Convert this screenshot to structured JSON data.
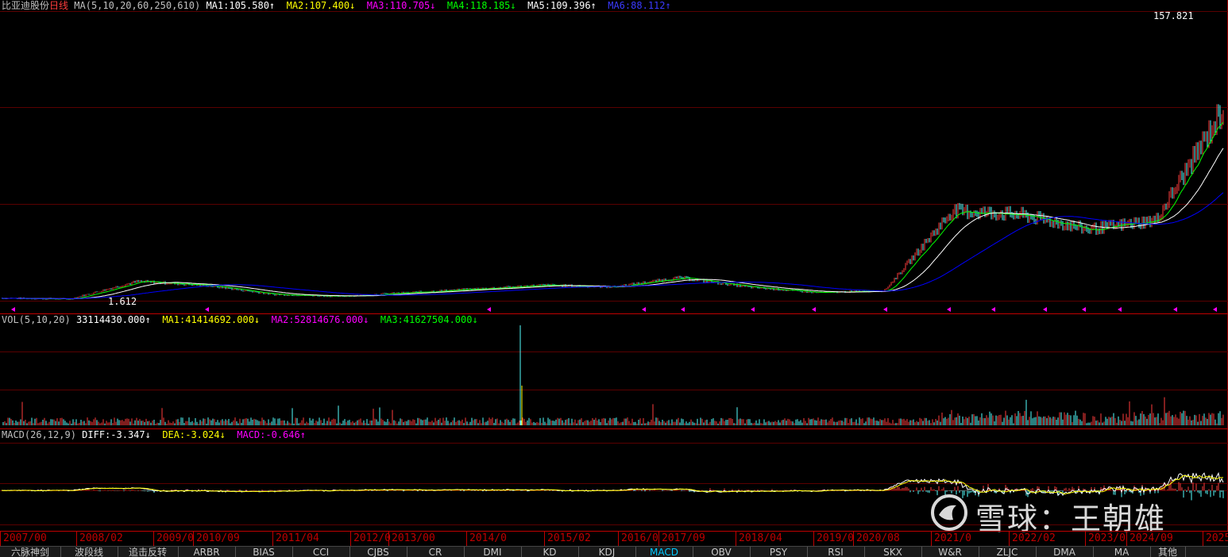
{
  "colors": {
    "background": "#000000",
    "grid": "#5a0000",
    "up": "#ff3c3c",
    "down": "#54ffff",
    "ma1": "#ffffff",
    "ma2": "#ffff00",
    "ma3": "#ff00ff",
    "ma4": "#00ff00",
    "ma5": "#ffffff",
    "ma6": "#0000ff",
    "arrow_marker": "#ff00ff"
  },
  "price_panel": {
    "stock_name": "比亚迪股份",
    "period": "日线",
    "ma_params": "MA(5,10,20,60,250,610)",
    "ma1_label": "MA1:",
    "ma1_value": "105.580↑",
    "ma2_label": "MA2:",
    "ma2_value": "107.400↓",
    "ma3_label": "MA3:",
    "ma3_value": "110.705↓",
    "ma4_label": "MA4:",
    "ma4_value": "118.185↓",
    "ma5_label": "MA5:",
    "ma5_value": "109.396↑",
    "ma6_label": "MA6:",
    "ma6_value": "88.112↑",
    "max_label": "157.821",
    "min_label": "1.612"
  },
  "vol_panel": {
    "params": "VOL(5,10,20)",
    "vol_value": "33114430.000↑",
    "ma1_label": "MA1:",
    "ma1_value": "41414692.000↓",
    "ma2_label": "MA2:",
    "ma2_value": "52814676.000↓",
    "ma3_label": "MA3:",
    "ma3_value": "41627504.000↓"
  },
  "macd_panel": {
    "params": "MACD(26,12,9)",
    "diff_label": "DIFF:",
    "diff_value": "-3.347↓",
    "dea_label": "DEA:",
    "dea_value": "-3.024↓",
    "macd_label": "MACD:",
    "macd_value": "-0.646↑"
  },
  "x_axis": {
    "labels": [
      "2007/00",
      "2008/02",
      "2009/0",
      "2010/09",
      "2011/04",
      "2012/0",
      "2013/00",
      "2014/0",
      "2015/02",
      "2016/0",
      "2017/09",
      "2018/04",
      "2019/0",
      "2020/08",
      "2021/0",
      "2022/02",
      "2023/0",
      "2024/09",
      "2025"
    ]
  },
  "tabs": [
    "六脉神剑",
    "波段线",
    "追击反转",
    "ARBR",
    "BIAS",
    "CCI",
    "CJBS",
    "CR",
    "DMI",
    "KD",
    "KDJ",
    "MACD",
    "OBV",
    "PSY",
    "RSI",
    "SKX",
    "W&R",
    "ZLJC",
    "DMA",
    "MA",
    "其他"
  ],
  "active_tab": "MACD",
  "watermark": {
    "text": "雪球：王朝雄",
    "logo_icon": "snowball-logo-icon"
  },
  "chart_data": {
    "type": "line",
    "title": "比亚迪股份 日线",
    "x": [
      2007,
      2008,
      2009,
      2010,
      2011,
      2012,
      2013,
      2014,
      2015,
      2016,
      2017,
      2018,
      2019,
      2020,
      2021,
      2022,
      2023,
      2024,
      2025
    ],
    "series": [
      {
        "name": "MA1",
        "values": [
          3,
          2.5,
          12,
          10,
          5,
          4,
          6,
          8,
          10,
          9,
          14,
          9,
          6,
          7,
          50,
          48,
          40,
          45,
          105.58
        ]
      }
    ],
    "ylim": [
      1.612,
      157.821
    ]
  }
}
